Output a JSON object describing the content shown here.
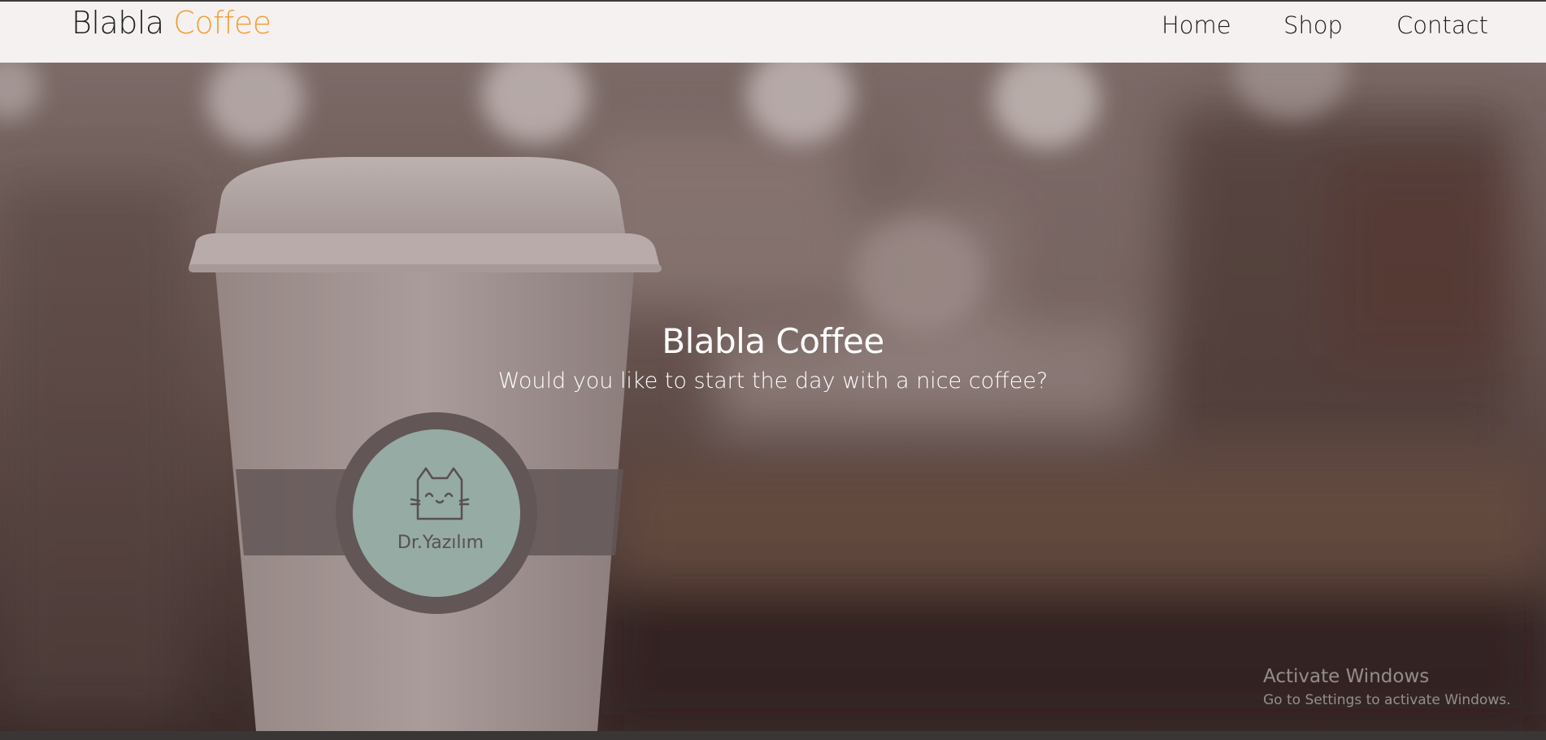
{
  "navbar": {
    "brand_main": "Blabla",
    "brand_accent": "Coffee",
    "links": [
      "Home",
      "Shop",
      "Contact"
    ]
  },
  "hero": {
    "title": "Blabla Coffee",
    "subtitle": "Would you like to start the day with a nice coffee?",
    "cup_logo_text": "Dr.Yazılım"
  },
  "watermark": {
    "title": "Activate Windows",
    "subtitle": "Go to Settings to activate Windows."
  },
  "colors": {
    "brand_accent": "#f0a13a",
    "navbar_bg": "#f5f1f0",
    "logo_circle": "#a9c9c0"
  },
  "icons": [
    "cat-face-icon"
  ]
}
